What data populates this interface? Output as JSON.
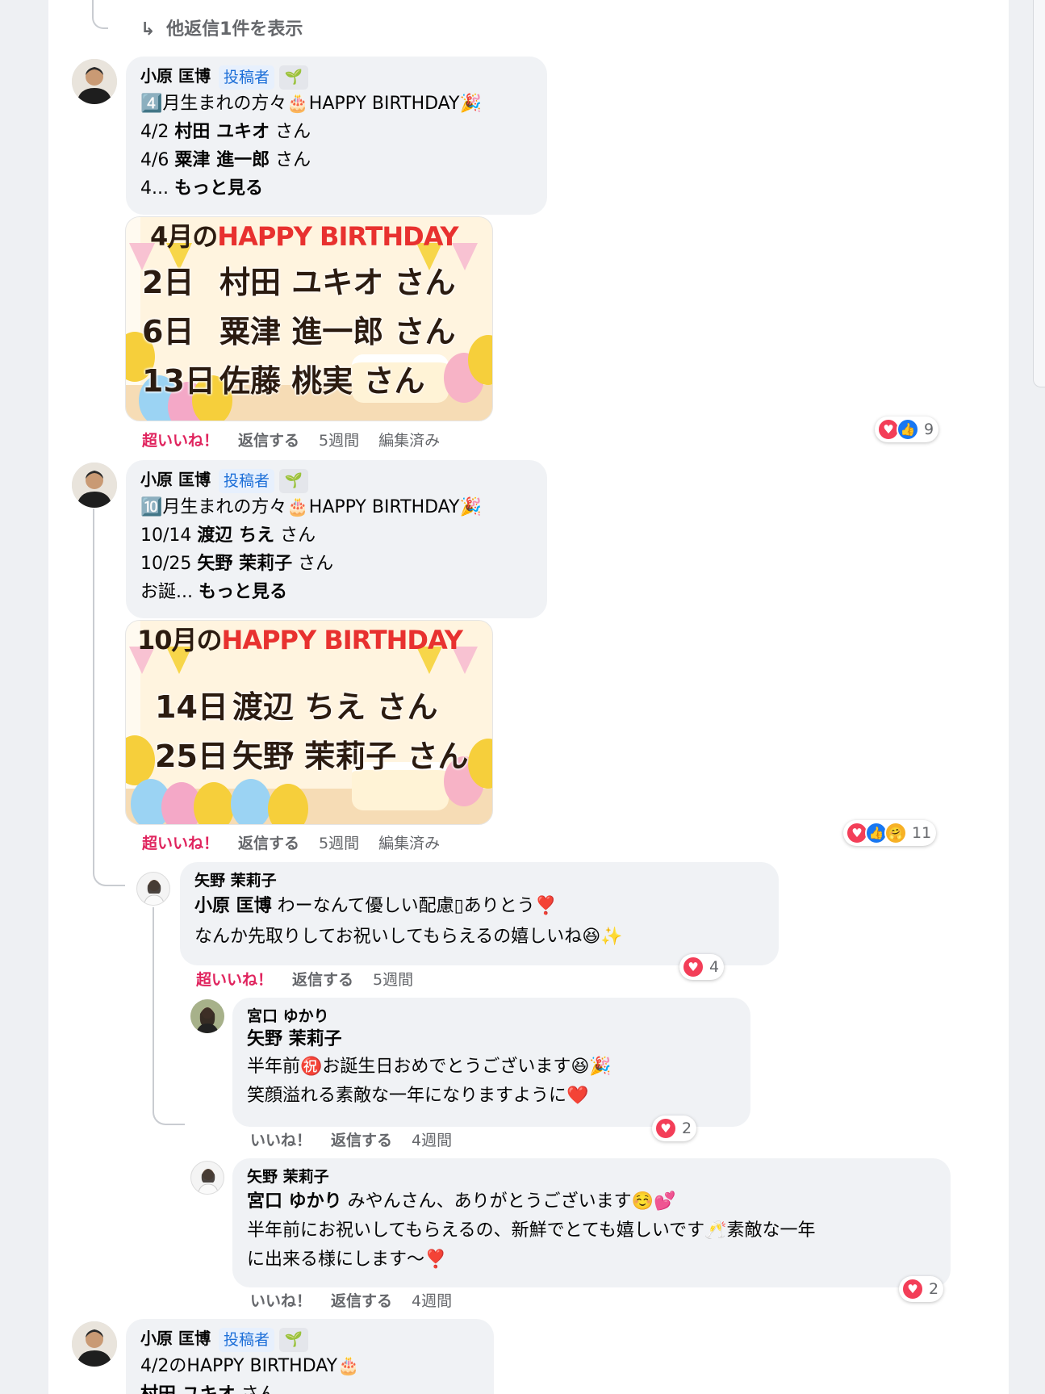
{
  "more_replies": {
    "icon": "↳",
    "label": "他返信1件を表示"
  },
  "comments": [
    {
      "author": "小原 匡博",
      "badge": "投稿者",
      "lines": [
        {
          "pre": "4️⃣月生まれの方々🎂HAPPY BIRTHDAY🎉",
          "bold": "",
          "post": ""
        },
        {
          "pre": "4/2 ",
          "bold": "村田 ユキオ",
          "post": " さん"
        },
        {
          "pre": "4/6 ",
          "bold": "粟津 進一郎",
          "post": " さん"
        },
        {
          "pre": "4... ",
          "bold": "もっと見る",
          "post": ""
        }
      ],
      "card": {
        "title_prefix": "4月の",
        "title": "HAPPY BIRTHDAY",
        "rows": [
          {
            "day": "2日",
            "name": "村田 ユキオ さん"
          },
          {
            "day": "6日",
            "name": "粟津 進一郎 さん"
          },
          {
            "day": "13日",
            "name": "佐藤 桃実 さん"
          }
        ]
      },
      "actions": {
        "react": "超いいね！",
        "reply": "返信する",
        "time": "5週間",
        "edited": "編集済み"
      },
      "reactions": {
        "icons": [
          "heart-icon",
          "like-icon"
        ],
        "count": "9"
      }
    },
    {
      "author": "小原 匡博",
      "badge": "投稿者",
      "lines": [
        {
          "pre": "🔟月生まれの方々🎂HAPPY BIRTHDAY🎉",
          "bold": "",
          "post": ""
        },
        {
          "pre": "10/14 ",
          "bold": "渡辺 ちえ",
          "post": " さん"
        },
        {
          "pre": "10/25 ",
          "bold": "矢野 茉莉子",
          "post": " さん"
        },
        {
          "pre": "お誕... ",
          "bold": "もっと見る",
          "post": ""
        }
      ],
      "card": {
        "title_prefix": "10月の",
        "title": "HAPPY BIRTHDAY",
        "rows": [
          {
            "day": "14日",
            "name": "渡辺 ちえ さん"
          },
          {
            "day": "25日",
            "name": "矢野 茉莉子 さん"
          }
        ]
      },
      "actions": {
        "react": "超いいね！",
        "reply": "返信する",
        "time": "5週間",
        "edited": "編集済み"
      },
      "reactions": {
        "icons": [
          "heart-icon",
          "like-icon",
          "care-icon"
        ],
        "count": "11"
      }
    }
  ],
  "replies": [
    {
      "author": "矢野 茉莉子",
      "lines": [
        {
          "pre": "",
          "bold": "小原 匡博",
          "post": " わーなんて優しい配慮▯ありとう❣️"
        },
        {
          "pre": "なんか先取りしてお祝いしてもらえるの嬉しいね😆✨",
          "bold": "",
          "post": ""
        }
      ],
      "actions": {
        "react": "超いいね！",
        "reply": "返信する",
        "time": "5週間"
      },
      "reactions": {
        "count": "4"
      }
    },
    {
      "author": "宮口 ゆかり",
      "lines": [
        {
          "pre": "",
          "bold": "矢野 茉莉子",
          "post": ""
        },
        {
          "pre": "半年前㊗️お誕生日おめでとうございます😆🎉",
          "bold": "",
          "post": ""
        },
        {
          "pre": "笑顔溢れる素敵な一年になりますように❤️",
          "bold": "",
          "post": ""
        }
      ],
      "actions": {
        "react": "いいね！",
        "reply": "返信する",
        "time": "4週間"
      },
      "reactions": {
        "count": "2"
      }
    },
    {
      "author": "矢野 茉莉子",
      "lines": [
        {
          "pre": "",
          "bold": "宮口 ゆかり",
          "post": " みやんさん、ありがとうございます☺️💕"
        },
        {
          "pre": "半年前にお祝いしてもらえるの、新鮮でとても嬉しいです🥂素敵な一年",
          "bold": "",
          "post": ""
        },
        {
          "pre": "に出来る様にします〜❣️",
          "bold": "",
          "post": ""
        }
      ],
      "actions": {
        "react": "いいね！",
        "reply": "返信する",
        "time": "4週間"
      },
      "reactions": {
        "count": "2"
      }
    }
  ],
  "last_comment": {
    "author": "小原 匡博",
    "badge": "投稿者",
    "lines": [
      {
        "pre": "4/2のHAPPY BIRTHDAY🎂",
        "bold": "",
        "post": ""
      },
      {
        "pre": "",
        "bold": "村田 ユキオ",
        "post": " さん"
      }
    ]
  },
  "colors": {
    "love": "#e0245e",
    "badge_bg": "#e7f0fd",
    "badge_fg": "#1d6fd8",
    "bubble": "#f0f2f5"
  }
}
